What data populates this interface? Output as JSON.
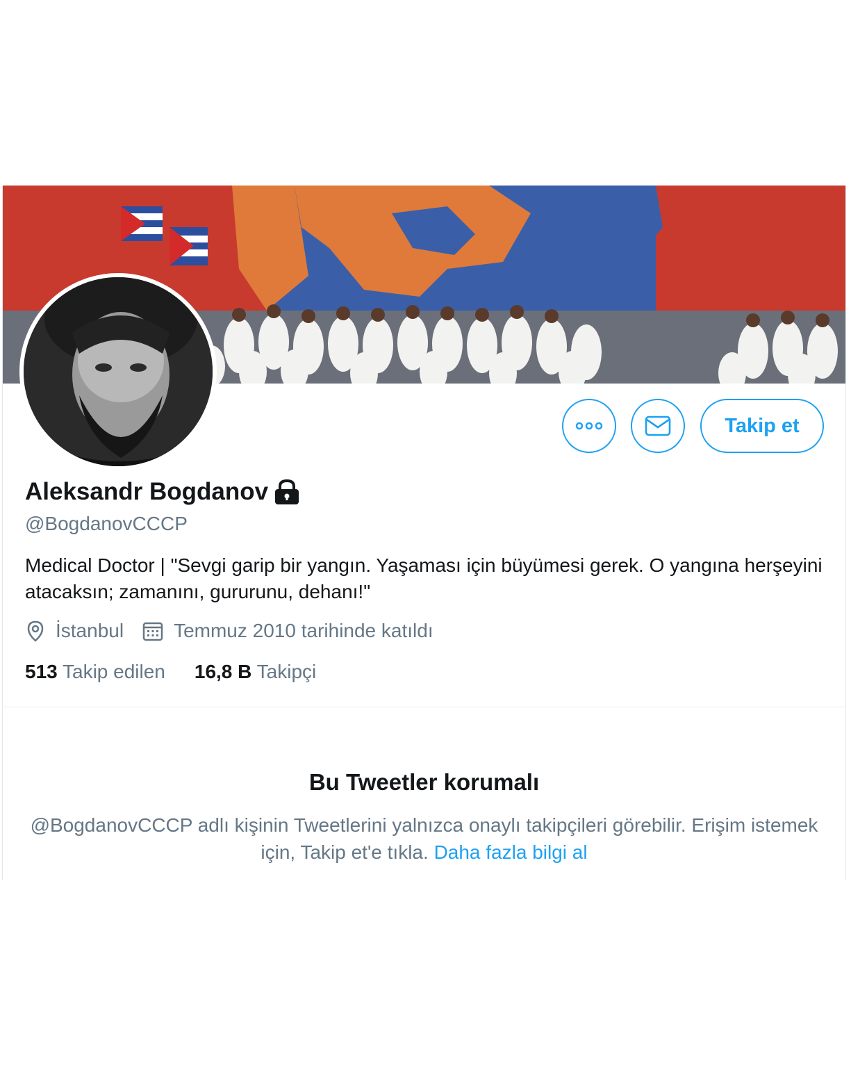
{
  "profile": {
    "name": "Aleksandr Bogdanov",
    "handle": "@BogdanovCCCP",
    "bio": "Medical Doctor | \"Sevgi garip bir yangın. Yaşaması için büyümesi gerek. O yangına herşeyini atacaksın; zamanını, gururunu, dehanı!\"",
    "location": "İstanbul",
    "joined": "Temmuz 2010 tarihinde katıldı"
  },
  "actions": {
    "follow_label": "Takip et",
    "more_icon": "more-icon",
    "message_icon": "envelope-icon"
  },
  "stats": {
    "following_count": "513",
    "following_label": "Takip edilen",
    "followers_count": "16,8 B",
    "followers_label": "Takipçi"
  },
  "protected": {
    "title": "Bu Tweetler korumalı",
    "message": "@BogdanovCCCP adlı kişinin Tweetlerini yalnızca onaylı takipçileri görebilir. Erişim istemek için, Takip et'e tıkla.",
    "link": "Daha fazla bilgi al"
  },
  "colors": {
    "accent": "#1da1f2",
    "text": "#14171a",
    "secondary": "#657786"
  }
}
